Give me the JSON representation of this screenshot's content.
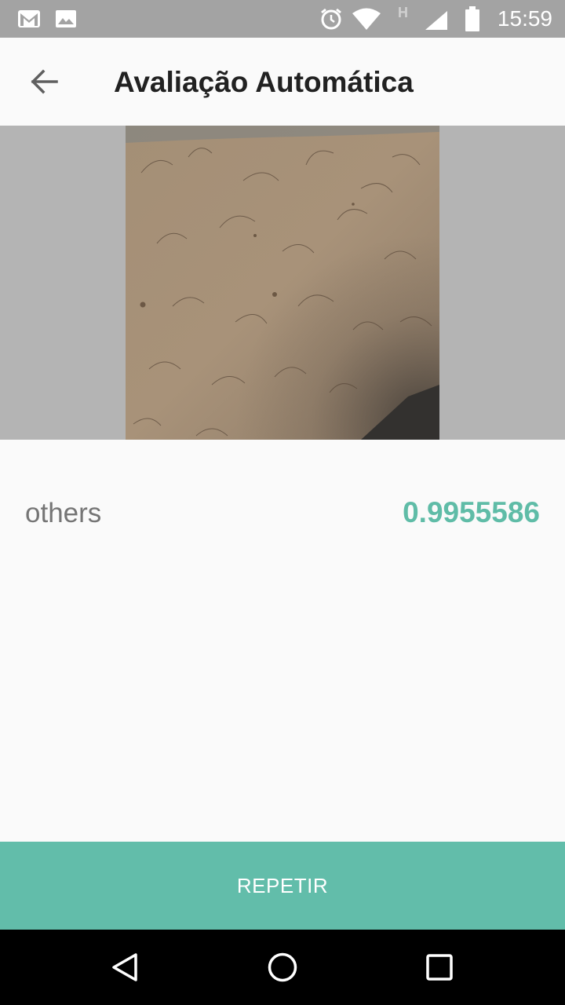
{
  "status_bar": {
    "time": "15:59",
    "network_letter": "H",
    "icons": [
      "gmail-icon",
      "image-notification-icon",
      "alarm-icon",
      "wifi-icon",
      "signal-icon",
      "battery-icon"
    ]
  },
  "app_bar": {
    "title": "Avaliação Automática",
    "back_icon": "arrow-back-icon"
  },
  "result": {
    "label": "others",
    "value": "0.9955586"
  },
  "actions": {
    "repeat_label": "REPETIR"
  },
  "nav_bar": {
    "icons": [
      "back-triangle-icon",
      "home-circle-icon",
      "recents-square-icon"
    ]
  },
  "colors": {
    "accent": "#62bdaa",
    "value_text": "#5fbca7",
    "status_bar": "#a3a3a3",
    "image_background": "#b4b4b4"
  }
}
